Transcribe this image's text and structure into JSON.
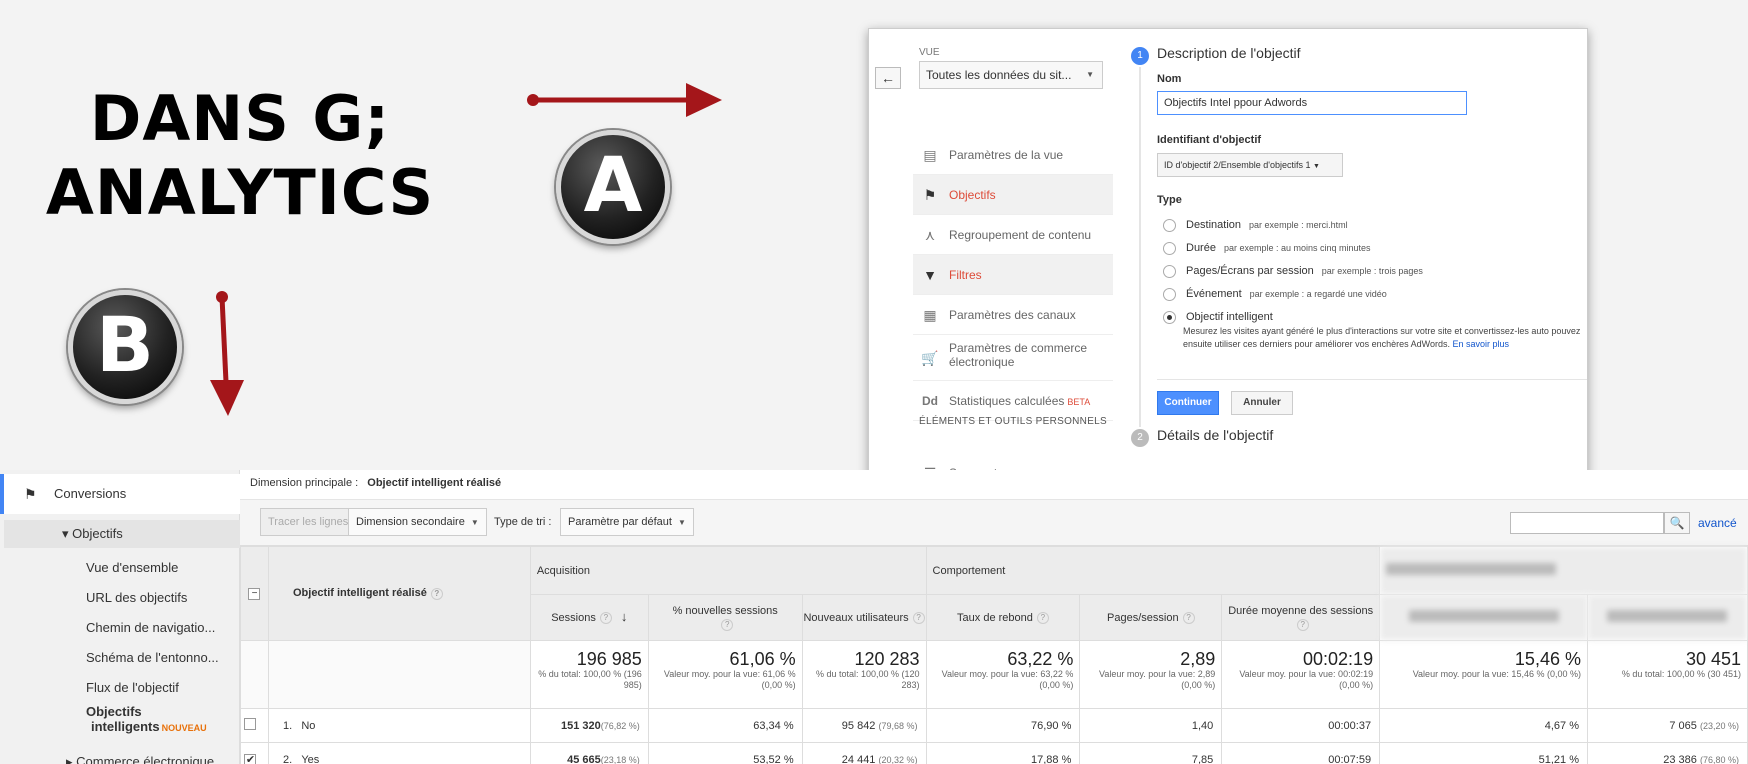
{
  "title": {
    "line1": "DANS G;",
    "line2": "ANALYTICS"
  },
  "badges": {
    "a": "A",
    "b": "B"
  },
  "colors": {
    "arrow": "#a4161a",
    "ga_blue": "#4285f4",
    "ga_red": "#dd4b39",
    "link": "#1155cc",
    "new_orange": "#e8710a"
  },
  "panel": {
    "back_icon": "arrow-left-icon",
    "vue_label": "VUE",
    "vue_select": "Toutes les données du sit...",
    "nav": [
      {
        "label": "Paramètres de la vue",
        "icon": "page-icon"
      },
      {
        "label": "Objectifs",
        "icon": "flag-icon"
      },
      {
        "label": "Regroupement de contenu",
        "icon": "merge-icon"
      },
      {
        "label": "Filtres",
        "icon": "filter-icon"
      },
      {
        "label": "Paramètres des canaux",
        "icon": "channels-icon"
      },
      {
        "label": "Paramètres de commerce électronique",
        "icon": "cart-icon"
      },
      {
        "label": "Statistiques calculées",
        "badge": "BETA",
        "icon": "dd-icon",
        "icon_text": "Dd"
      }
    ],
    "section": "ÉLÉMENTS ET OUTILS PERSONNELS",
    "segments": "Segments",
    "step1": {
      "num": "1",
      "title": "Description de l'objectif"
    },
    "name_label": "Nom",
    "name_value": "Objectifs Intel ppour Adwords",
    "id_label": "Identifiant d'objectif",
    "id_value": "ID d'objectif 2/Ensemble d'objectifs 1",
    "type_label": "Type",
    "types": [
      {
        "label": "Destination",
        "example": "par exemple : merci.html",
        "checked": false
      },
      {
        "label": "Durée",
        "example": "par exemple : au moins cinq minutes",
        "checked": false
      },
      {
        "label": "Pages/Écrans par session",
        "example": "par exemple : trois pages",
        "checked": false
      },
      {
        "label": "Événement",
        "example": "par exemple : a regardé une vidéo",
        "checked": false
      },
      {
        "label": "Objectif intelligent",
        "example": "",
        "checked": true
      }
    ],
    "smart_desc": "Mesurez les visites ayant généré le plus d'interactions sur votre site et convertissez-les auto pouvez ensuite utiliser ces derniers pour améliorer vos enchères AdWords.",
    "smart_link": "En savoir plus",
    "continue": "Continuer",
    "cancel": "Annuler",
    "step2": {
      "num": "2",
      "title": "Détails de l'objectif"
    }
  },
  "sidebar": {
    "conversions": "Conversions",
    "objectifs": "▾ Objectifs",
    "items": [
      "Vue d'ensemble",
      "URL des objectifs",
      "Chemin de navigatio...",
      "Schéma de l'entonno...",
      "Flux de l'objectif"
    ],
    "smart_line1": "Objectifs",
    "smart_line2": "intelligents",
    "smart_badge": "NOUVEAU",
    "commerce": "▸ Commerce électronique"
  },
  "report": {
    "dim_label": "Dimension principale :",
    "dim_value": "Objectif intelligent réalisé",
    "toolbar": {
      "plot": "Tracer les lignes",
      "secondary": "Dimension secondaire",
      "sort_label": "Type de tri :",
      "sort_value": "Paramètre par défaut",
      "advanced": "avancé"
    },
    "dim_header": "Objectif intelligent réalisé",
    "groups": {
      "acquisition": "Acquisition",
      "comportement": "Comportement"
    },
    "columns": [
      "Sessions",
      "% nouvelles sessions",
      "Nouveaux utilisateurs",
      "Taux de rebond",
      "Pages/session",
      "Durée moyenne des sessions"
    ],
    "totals": [
      {
        "value": "196 985",
        "sub": "% du total: 100,00 % (196 985)"
      },
      {
        "value": "61,06 %",
        "sub": "Valeur moy. pour la vue: 61,06 % (0,00 %)"
      },
      {
        "value": "120 283",
        "sub": "% du total: 100,00 % (120 283)"
      },
      {
        "value": "63,22 %",
        "sub": "Valeur moy. pour la vue: 63,22 % (0,00 %)"
      },
      {
        "value": "2,89",
        "sub": "Valeur moy. pour la vue: 2,89 (0,00 %)"
      },
      {
        "value": "00:02:19",
        "sub": "Valeur moy. pour la vue: 00:02:19 (0,00 %)"
      },
      {
        "value": "15,46 %",
        "sub": "Valeur moy. pour la vue: 15,46 % (0,00 %)"
      },
      {
        "value": "30 451",
        "sub": "% du total: 100,00 % (30 451)"
      }
    ],
    "rows": [
      {
        "checked": false,
        "num": "1.",
        "label": "No",
        "sessions": "151 320",
        "sessions_pct": "(76,82 %)",
        "new_sessions": "63,34 %",
        "new_users": "95 842",
        "new_users_pct": "(79,68 %)",
        "bounce": "76,90 %",
        "pages": "1,40",
        "duration": "00:00:37",
        "conv_rate": "4,67 %",
        "conv": "7 065",
        "conv_pct": "(23,20 %)"
      },
      {
        "checked": true,
        "num": "2.",
        "label": "Yes",
        "sessions": "45 665",
        "sessions_pct": "(23,18 %)",
        "new_sessions": "53,52 %",
        "new_users": "24 441",
        "new_users_pct": "(20,32 %)",
        "bounce": "17,88 %",
        "pages": "7,85",
        "duration": "00:07:59",
        "conv_rate": "51,21 %",
        "conv": "23 386",
        "conv_pct": "(76,80 %)"
      }
    ]
  }
}
